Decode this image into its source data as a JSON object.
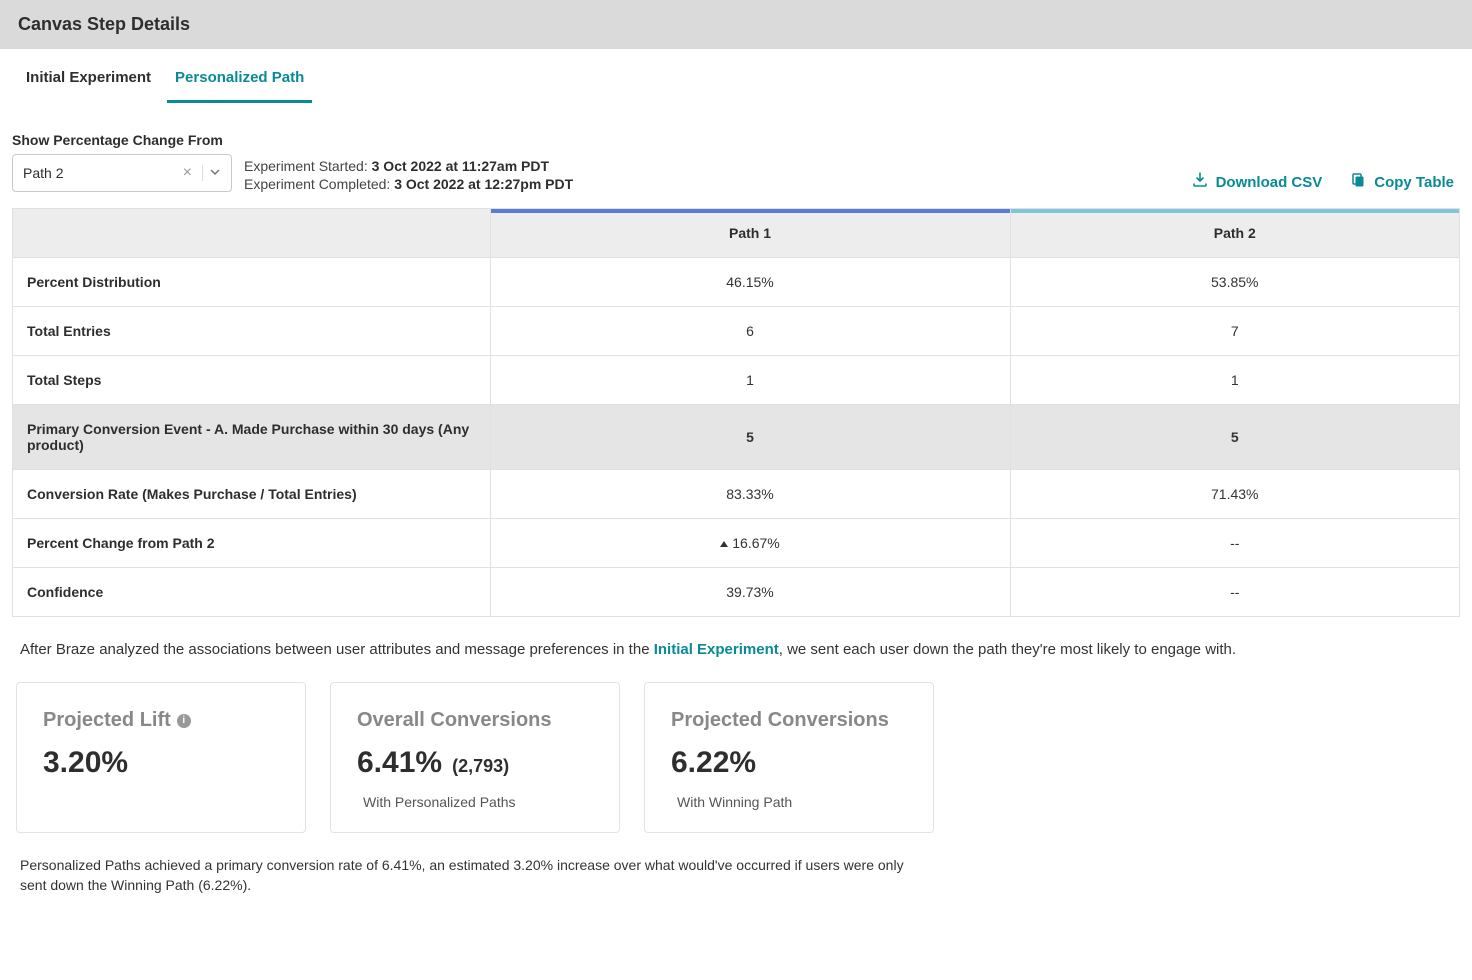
{
  "header": {
    "title": "Canvas Step Details"
  },
  "tabs": {
    "initial": "Initial Experiment",
    "personalized": "Personalized Path"
  },
  "controls": {
    "select_label": "Show Percentage Change From",
    "select_value": "Path 2",
    "started_label": "Experiment Started: ",
    "started_value": "3 Oct 2022 at 11:27am PDT",
    "completed_label": "Experiment Completed: ",
    "completed_value": "3 Oct 2022 at 12:27pm PDT",
    "download_csv": "Download CSV",
    "copy_table": "Copy Table"
  },
  "table": {
    "col1": "Path 1",
    "col2": "Path 2",
    "rows": {
      "percent_dist": {
        "label": "Percent Distribution",
        "p1": "46.15%",
        "p2": "53.85%"
      },
      "total_entries": {
        "label": "Total Entries",
        "p1": "6",
        "p2": "7"
      },
      "total_steps": {
        "label": "Total Steps",
        "p1": "1",
        "p2": "1"
      },
      "primary_conv": {
        "label": "Primary Conversion Event - A. Made Purchase within 30 days (Any product)",
        "p1": "5",
        "p2": "5"
      },
      "conv_rate": {
        "label": "Conversion Rate (Makes Purchase / Total Entries)",
        "p1": "83.33%",
        "p2": "71.43%"
      },
      "pct_change": {
        "label": "Percent Change from Path 2",
        "p1": "16.67%",
        "p2": "--"
      },
      "confidence": {
        "label": "Confidence",
        "p1": "39.73%",
        "p2": "--"
      }
    }
  },
  "analysis": {
    "pre": "After Braze analyzed the associations between user attributes and message preferences in the ",
    "link": "Initial Experiment",
    "post": ", we sent each user down the path they're most likely to engage with."
  },
  "cards": {
    "lift": {
      "title": "Projected Lift",
      "value": "3.20%"
    },
    "overall": {
      "title": "Overall Conversions",
      "value": "6.41%",
      "count": "(2,793)",
      "caption": "With Personalized Paths"
    },
    "projected": {
      "title": "Projected Conversions",
      "value": "6.22%",
      "caption": "With Winning Path"
    }
  },
  "footnote": "Personalized Paths achieved a primary conversion rate of 6.41%, an estimated 3.20% increase over what would've occurred if users were only sent down the Winning Path (6.22%)."
}
